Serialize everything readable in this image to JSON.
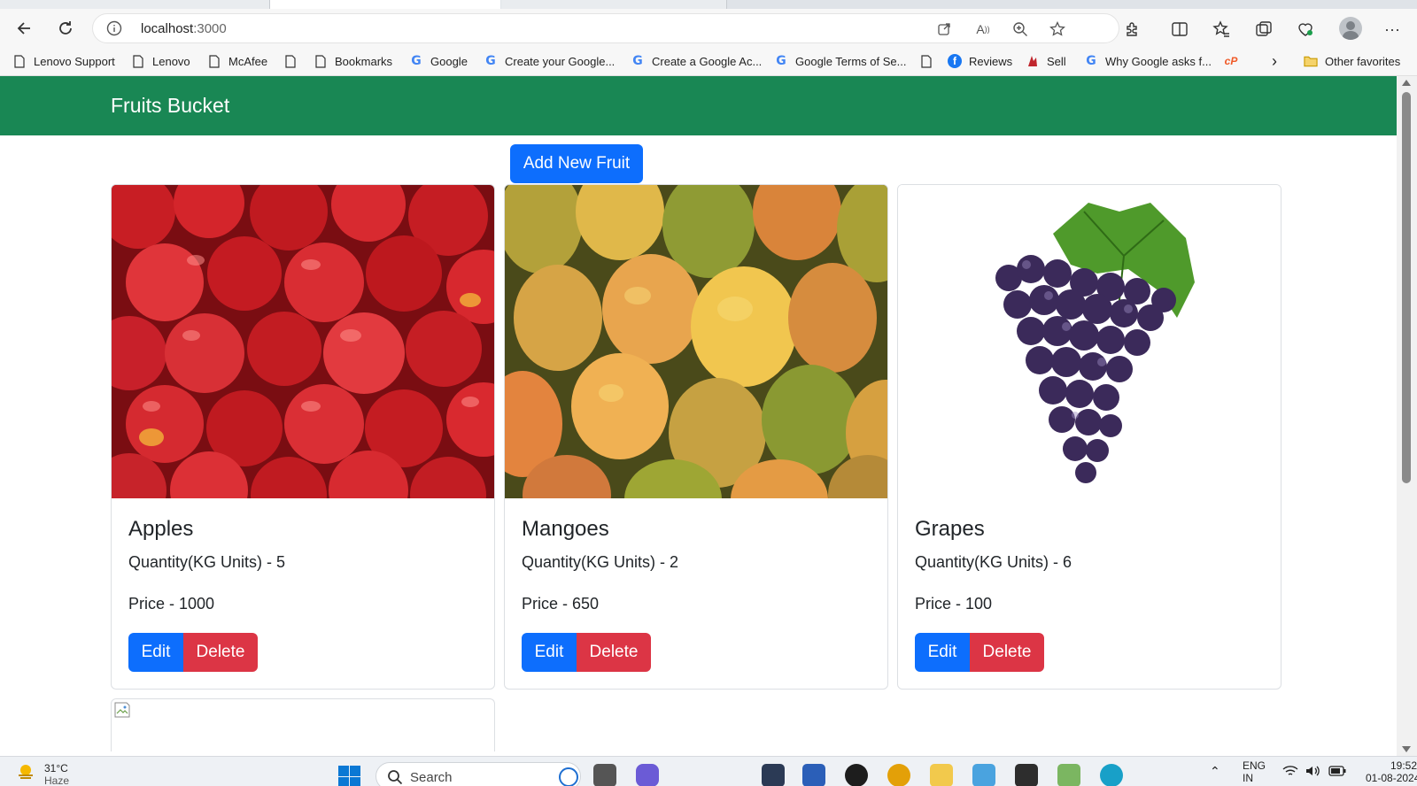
{
  "browser": {
    "url_host": "localhost",
    "url_port": ":3000",
    "bookmarks": [
      {
        "label": "Lenovo Support",
        "icon": "page-icon"
      },
      {
        "label": "Lenovo",
        "icon": "page-icon"
      },
      {
        "label": "McAfee",
        "icon": "page-icon"
      },
      {
        "label": "",
        "icon": "page-icon"
      },
      {
        "label": "Bookmarks",
        "icon": "page-icon"
      },
      {
        "label": "Google",
        "icon": "google-icon"
      },
      {
        "label": "Create your Google...",
        "icon": "google-icon"
      },
      {
        "label": "Create a Google Ac...",
        "icon": "google-icon"
      },
      {
        "label": "Google Terms of Se...",
        "icon": "google-icon"
      },
      {
        "label": "",
        "icon": "page-icon"
      },
      {
        "label": "Reviews",
        "icon": "facebook-icon"
      },
      {
        "label": "Sell",
        "icon": "sell-icon"
      },
      {
        "label": "Why Google asks f...",
        "icon": "google-icon"
      },
      {
        "label": "",
        "icon": "cp-icon"
      }
    ],
    "other_favorites": "Other favorites",
    "more_bookmarks": "›"
  },
  "app": {
    "brand": "Fruits Bucket",
    "add_button": "Add New Fruit",
    "fruits": [
      {
        "name": "Apples",
        "quantity": "Quantity(KG Units) - 5",
        "price": "Price - 1000",
        "edit": "Edit",
        "delete": "Delete"
      },
      {
        "name": "Mangoes",
        "quantity": "Quantity(KG Units) - 2",
        "price": "Price - 650",
        "edit": "Edit",
        "delete": "Delete"
      },
      {
        "name": "Grapes",
        "quantity": "Quantity(KG Units) - 6",
        "price": "Price - 100",
        "edit": "Edit",
        "delete": "Delete"
      }
    ]
  },
  "taskbar": {
    "temperature": "31°C",
    "weather": "Haze",
    "search": "Search",
    "lang": "ENG",
    "region": "IN",
    "time": "19:52",
    "date": "01-08-2024"
  },
  "colors": {
    "navbar": "#198754",
    "primary": "#0d6efd",
    "danger": "#dc3545"
  }
}
